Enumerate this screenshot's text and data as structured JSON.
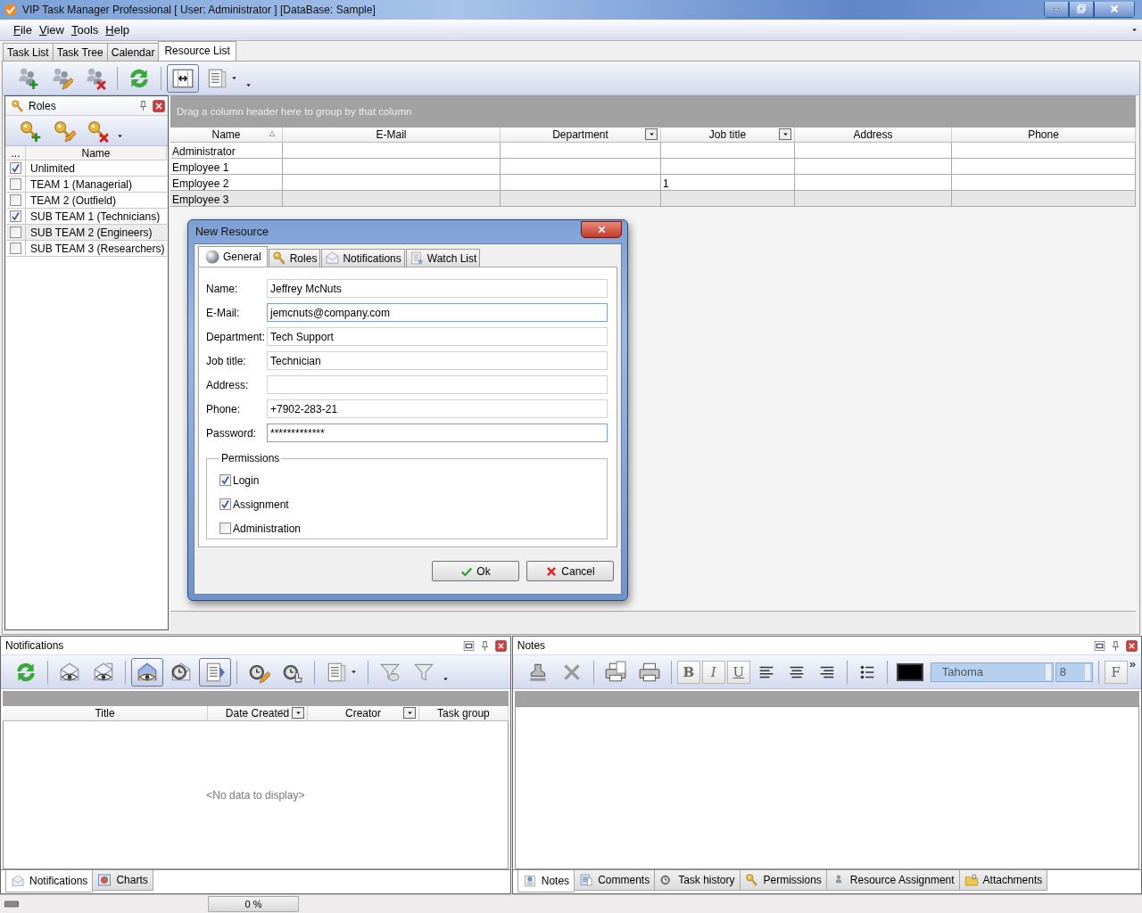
{
  "window": {
    "title": "VIP Task Manager Professional [ User: Administrator ] [DataBase: Sample]"
  },
  "menu": [
    {
      "label": "File"
    },
    {
      "label": "View"
    },
    {
      "label": "Tools"
    },
    {
      "label": "Help"
    }
  ],
  "tabs": [
    {
      "label": "Task List",
      "selected": false
    },
    {
      "label": "Task Tree",
      "selected": false
    },
    {
      "label": "Calendar",
      "selected": false
    },
    {
      "label": "Resource List",
      "selected": true
    }
  ],
  "toolbar": {
    "buttons": [
      {
        "pressed": false
      },
      {
        "pressed": false
      },
      {
        "pressed": false
      },
      {
        "pressed": false
      },
      {
        "pressed": true
      },
      {
        "pressed": false
      }
    ]
  },
  "roles_panel": {
    "title": "Roles",
    "columns": [
      "...",
      "Name"
    ],
    "rows": [
      {
        "name": "Unlimited",
        "checked": true,
        "selected": false
      },
      {
        "name": "TEAM 1 (Managerial)",
        "checked": false,
        "selected": false
      },
      {
        "name": "TEAM 2 (Outfield)",
        "checked": false,
        "selected": false
      },
      {
        "name": "SUB TEAM 1 (Technicians)",
        "checked": true,
        "selected": false
      },
      {
        "name": "SUB TEAM 2 (Engineers)",
        "checked": false,
        "selected": true
      },
      {
        "name": "SUB TEAM 3 (Researchers)",
        "checked": false,
        "selected": false
      }
    ]
  },
  "grid": {
    "group_hint": "Drag a column header here to group by that column",
    "columns": [
      {
        "label": "Name",
        "sorted_ascending": true,
        "filter": false
      },
      {
        "label": "E-Mail",
        "filter": false
      },
      {
        "label": "Department",
        "filter": true
      },
      {
        "label": "Job title",
        "filter": true
      },
      {
        "label": "Address",
        "filter": false
      },
      {
        "label": "Phone",
        "filter": false
      }
    ],
    "rows": [
      {
        "name": "Administrator",
        "selected": false
      },
      {
        "name": "Employee 1",
        "selected": false
      },
      {
        "name": "Employee 2",
        "job_title": "1",
        "selected": false
      },
      {
        "name": "Employee 3",
        "selected": true
      }
    ]
  },
  "dialog": {
    "title": "New Resource",
    "tabs": [
      {
        "label": "General",
        "selected": true
      },
      {
        "label": "Roles",
        "selected": false
      },
      {
        "label": "Notifications",
        "selected": false
      },
      {
        "label": "Watch List",
        "selected": false
      }
    ],
    "fields": [
      {
        "label": "Name:",
        "value": "Jeffrey McNuts",
        "focused": false
      },
      {
        "label": "E-Mail:",
        "value": "jemcnuts@company.com",
        "focused": true
      },
      {
        "label": "Department:",
        "value": "Tech Support",
        "focused": false
      },
      {
        "label": "Job title:",
        "value": "Technician",
        "focused": false
      },
      {
        "label": "Address:",
        "focused": false
      },
      {
        "label": "Phone:",
        "value": "+7902-283-21",
        "focused": false
      },
      {
        "label": "Password:",
        "value": "*************",
        "focused": true
      }
    ],
    "permissions": {
      "title": "Permissions",
      "items": [
        {
          "label": "Login",
          "checked": true
        },
        {
          "label": "Assignment",
          "checked": true
        },
        {
          "label": "Administration",
          "checked": false
        }
      ]
    },
    "buttons": [
      {
        "label": "Ok",
        "kind": "ok"
      },
      {
        "label": "Cancel",
        "kind": "cancel"
      }
    ]
  },
  "notifications_pane": {
    "title": "Notifications",
    "toolbar": [
      {
        "pressed": false
      },
      {
        "pressed": false
      },
      {
        "pressed": false
      },
      {
        "pressed": true
      },
      {
        "pressed": false
      },
      {
        "pressed": true
      },
      {
        "pressed": false
      },
      {
        "pressed": false
      },
      {
        "pressed": false
      },
      {
        "pressed": false
      },
      {
        "pressed": false
      }
    ],
    "columns": [
      {
        "label": "Title",
        "filter": false
      },
      {
        "label": "Date Created",
        "sorted_descending": true,
        "filter": true
      },
      {
        "label": "Creator",
        "filter": true
      },
      {
        "label": "Task group",
        "filter": false
      }
    ],
    "empty_text": "<No data to display>",
    "tabs": [
      {
        "label": "Notifications",
        "selected": true
      },
      {
        "label": "Charts",
        "selected": false
      }
    ]
  },
  "notes_pane": {
    "title": "Notes",
    "format_buttons": [
      "B",
      "I",
      "U"
    ],
    "font": "Tahoma",
    "font_size": "8",
    "font_button": "F",
    "overflow": "»",
    "tabs": [
      {
        "label": "Notes",
        "selected": true
      },
      {
        "label": "Comments",
        "selected": false
      },
      {
        "label": "Task history",
        "selected": false
      },
      {
        "label": "Permissions",
        "selected": false
      },
      {
        "label": "Resource Assignment",
        "selected": false
      },
      {
        "label": "Attachments",
        "selected": false
      }
    ]
  },
  "status_bar": {
    "progress": {
      "level": 0,
      "reading": "0 %"
    }
  }
}
